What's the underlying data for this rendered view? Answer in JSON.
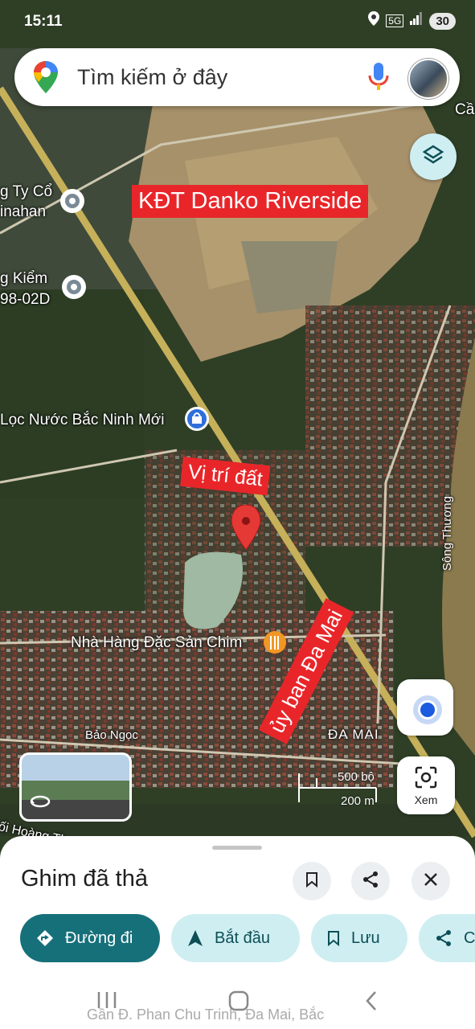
{
  "status_bar": {
    "time": "15:11",
    "network": "5G",
    "battery": "30"
  },
  "search": {
    "placeholder": "Tìm kiếm ở đây"
  },
  "annotations": {
    "danko": "KĐT Danko Riverside",
    "vitri": "Vị trí đất",
    "uyban": "ủy ban Đa Mai"
  },
  "map_labels": {
    "cong_ty": "g Ty Cổ",
    "inahan": "inahan",
    "kiem": "g Kiểm",
    "code": "98-02D",
    "loc_nuoc": "Lọc Nước Bắc Ninh Mới",
    "nha_hang": "Nhà Hàng Đặc Sản Chim",
    "bao_ngoc": "Bảo Ngọc",
    "da_mai": "ĐA MAI",
    "song_thuong": "Sông Thương",
    "hoang": "ối Hoàng Th",
    "ca": "Cầ"
  },
  "scale": {
    "imperial": "500 bộ",
    "metric": "200 m"
  },
  "view_button": {
    "label": "Xem"
  },
  "sheet": {
    "title": "Ghim đã thả",
    "actions": [
      {
        "label": "Đường đi",
        "icon": "directions-icon"
      },
      {
        "label": "Bắt đầu",
        "icon": "navigation-arrow-icon"
      },
      {
        "label": "Lưu",
        "icon": "bookmark-icon"
      },
      {
        "label": "C",
        "icon": "share-icon"
      }
    ],
    "address": "Gần Đ. Phan Chu Trinh, Đa Mai, Bắc"
  },
  "colors": {
    "accent": "#16707a",
    "chip_bg": "#cfeef2",
    "annotation_red": "#e8262a",
    "pin_red": "#e53935"
  }
}
